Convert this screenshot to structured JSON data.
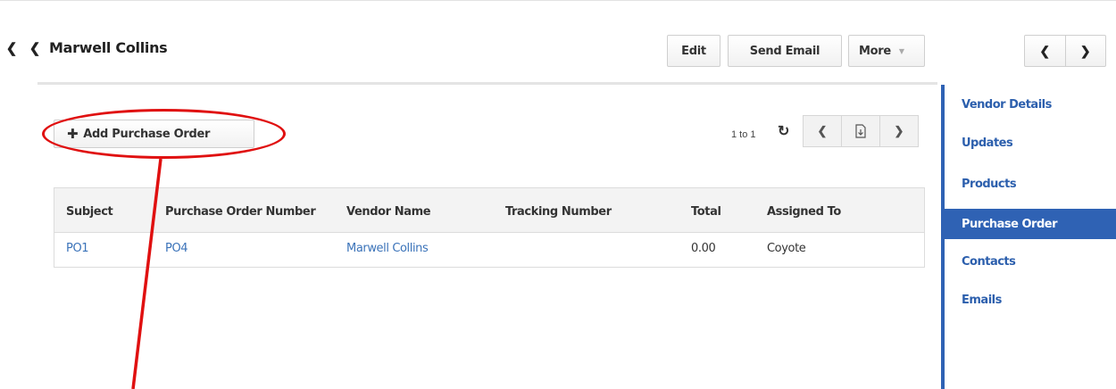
{
  "header": {
    "title": "Marwell Collins",
    "edit_label": "Edit",
    "send_email_label": "Send Email",
    "more_label": "More",
    "prev_icon": "chevron-left-icon",
    "next_icon": "chevron-right-icon"
  },
  "toolbar": {
    "add_label": "Add Purchase Order",
    "pager_text": "1 to 1"
  },
  "table": {
    "headers": [
      "Subject",
      "Purchase Order Number",
      "Vendor Name",
      "Tracking Number",
      "Total",
      "Assigned To"
    ],
    "rows": [
      [
        "PO1",
        "PO4",
        "Marwell Collins",
        "",
        "0.00",
        "Coyote"
      ]
    ]
  },
  "sidebar": {
    "items": [
      {
        "label": "Vendor Details"
      },
      {
        "label": "Updates"
      },
      {
        "label": "Products"
      },
      {
        "label": "Purchase Order",
        "active": true
      },
      {
        "label": "Contacts"
      },
      {
        "label": "Emails"
      }
    ]
  },
  "colors": {
    "accent": "#2f62b4",
    "link": "#3b73b9",
    "annotation": "#e01010"
  }
}
